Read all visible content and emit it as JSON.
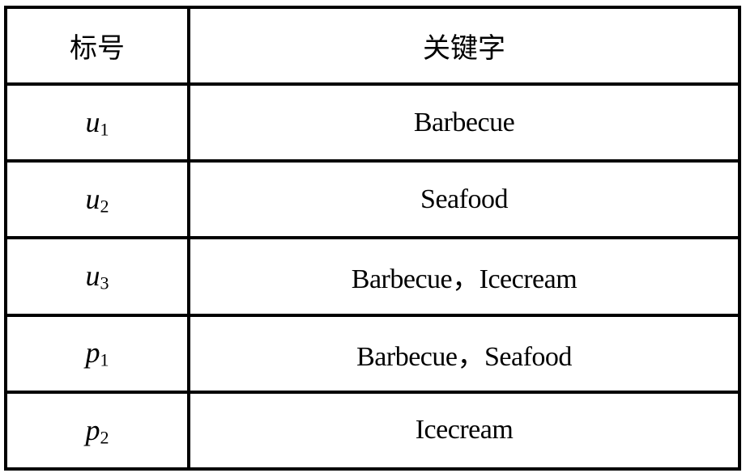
{
  "table": {
    "headers": [
      "标号",
      "关键字"
    ],
    "rows": [
      {
        "symbol": "u",
        "subscript": "1",
        "keywords": "Barbecue"
      },
      {
        "symbol": "u",
        "subscript": "2",
        "keywords": "Seafood"
      },
      {
        "symbol": "u",
        "subscript": "3",
        "keywords": "Barbecue，Icecream"
      },
      {
        "symbol": "p",
        "subscript": "1",
        "keywords": "Barbecue，Seafood"
      },
      {
        "symbol": "p",
        "subscript": "2",
        "keywords": "Icecream"
      }
    ]
  }
}
